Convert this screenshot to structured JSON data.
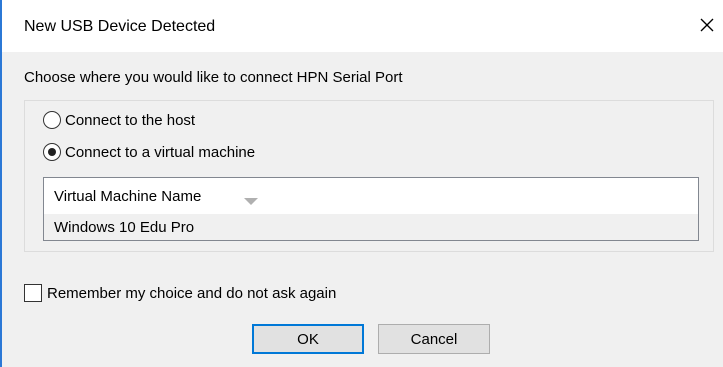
{
  "window": {
    "title": "New USB Device Detected",
    "accent_color": "#2b78d6"
  },
  "dialog": {
    "instruction": "Choose where you would like to connect HPN Serial Port",
    "options": [
      {
        "label": "Connect to the host",
        "selected": false
      },
      {
        "label": "Connect to a virtual machine",
        "selected": true
      }
    ],
    "vm_list": {
      "column_header": "Virtual Machine Name",
      "rows": [
        "Windows 10 Edu Pro"
      ]
    },
    "remember_label": "Remember my choice and do not ask again",
    "remember_checked": false,
    "ok_label": "OK",
    "cancel_label": "Cancel"
  }
}
